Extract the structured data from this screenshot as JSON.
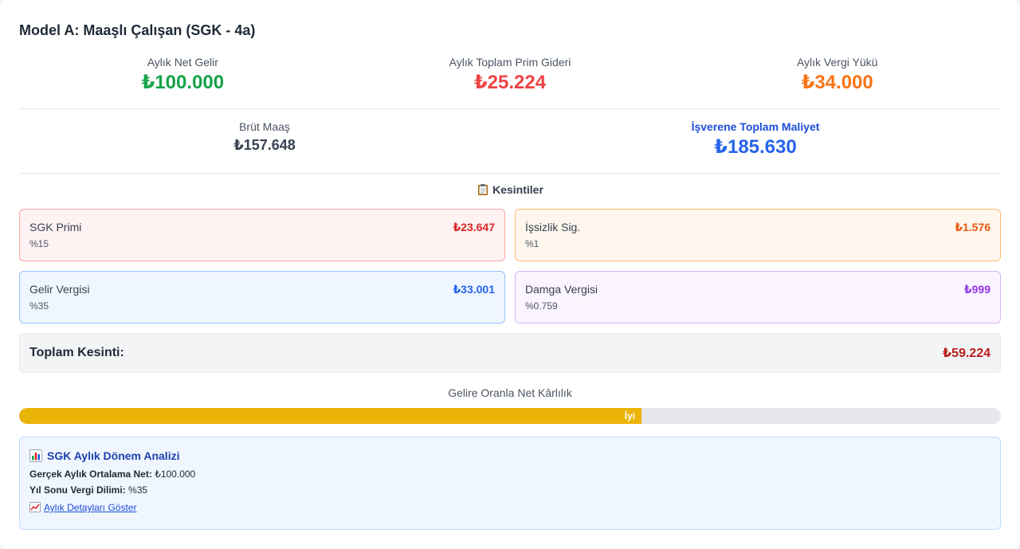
{
  "title": "Model A: Maaşlı Çalışan (SGK - 4a)",
  "summary": {
    "net_income_label": "Aylık Net Gelir",
    "net_income_value": "₺100.000",
    "premium_label": "Aylık Toplam Prim Gideri",
    "premium_value": "₺25.224",
    "tax_label": "Aylık Vergi Yükü",
    "tax_value": "₺34.000"
  },
  "salary": {
    "gross_label": "Brüt Maaş",
    "gross_value": "₺157.648",
    "employer_cost_label": "İşverene Toplam Maliyet",
    "employer_cost_value": "₺185.630"
  },
  "deductions": {
    "heading": "Kesintiler",
    "items": [
      {
        "name": "SGK Primi",
        "rate": "%15",
        "amount": "₺23.647"
      },
      {
        "name": "İşsizlik Sig.",
        "rate": "%1",
        "amount": "₺1.576"
      },
      {
        "name": "Gelir Vergisi",
        "rate": "%35",
        "amount": "₺33.001"
      },
      {
        "name": "Damga Vergisi",
        "rate": "%0.759",
        "amount": "₺999"
      }
    ],
    "total_label": "Toplam Kesinti:",
    "total_value": "₺59.224"
  },
  "profitability": {
    "label": "Gelire Oranla Net Kârlılık",
    "rating": "İyi",
    "fill_fraction": 0.634,
    "fill_color": "#eab308"
  },
  "analysis": {
    "heading": "SGK Aylık Dönem Analizi",
    "avg_net_label": "Gerçek Aylık Ortalama Net:",
    "avg_net_value": "₺100.000",
    "bracket_label": "Yıl Sonu Vergi Dilimi:",
    "bracket_value": "%35",
    "details_link": "Aylık Detayları Göster"
  },
  "icons": {
    "deductions": "clipboard-icon",
    "analysis": "bar-chart-icon",
    "details": "trend-chart-icon"
  }
}
